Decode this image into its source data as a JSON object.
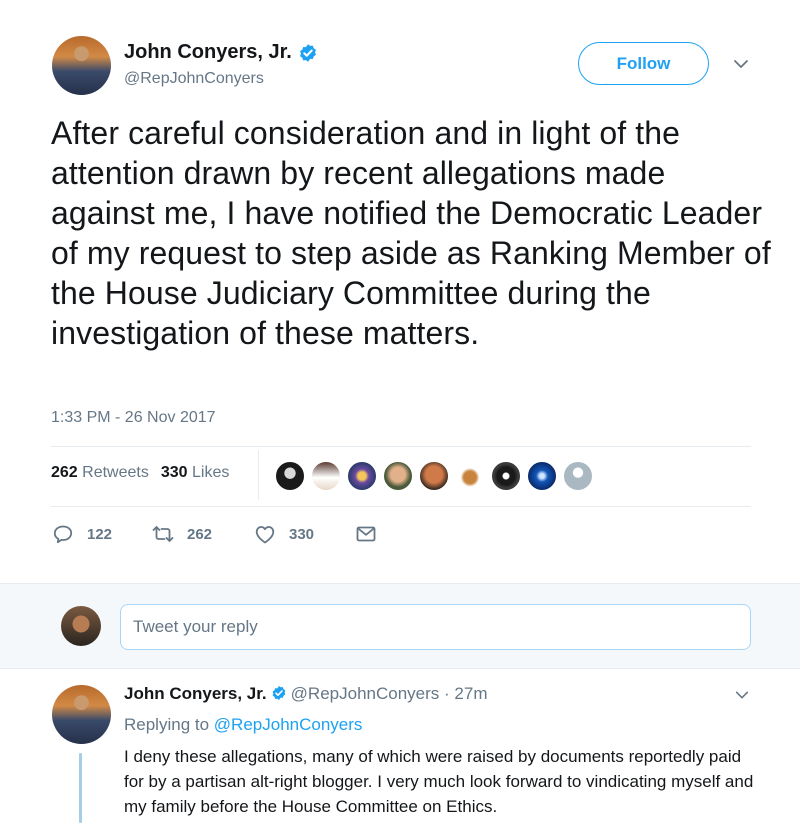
{
  "tweet": {
    "author_name": "John Conyers, Jr.",
    "author_handle": "@RepJohnConyers",
    "follow_label": "Follow",
    "text": "After careful consideration and in light of the attention drawn by recent allegations made against me, I have notified the Democratic Leader of my request to step aside as Ranking Member of the House Judiciary Committee during the investigation of these matters.",
    "timestamp": "1:33 PM - 26 Nov 2017",
    "retweets_count": "262",
    "retweets_label": "Retweets",
    "likes_count": "330",
    "likes_label": "Likes",
    "actions": {
      "reply_count": "122",
      "retweet_count": "262",
      "like_count": "330"
    },
    "colors": {
      "accent": "#1da1f2",
      "muted": "#657786",
      "text": "#14171a"
    }
  },
  "reply_box": {
    "placeholder": "Tweet your reply"
  },
  "reply": {
    "author_name": "John Conyers, Jr.",
    "author_handle": "@RepJohnConyers",
    "separator": "·",
    "time_ago": "27m",
    "replying_prefix": "Replying to",
    "replying_to": "@RepJohnConyers",
    "text": "I deny these allegations, many of which were raised by documents reportedly paid for by a partisan alt-right blogger. I very much look forward to vindicating myself and my family before the House Committee on Ethics."
  },
  "icons": [
    "verified-badge-icon",
    "chevron-down-icon",
    "reply-icon",
    "retweet-icon",
    "heart-icon",
    "message-icon"
  ]
}
